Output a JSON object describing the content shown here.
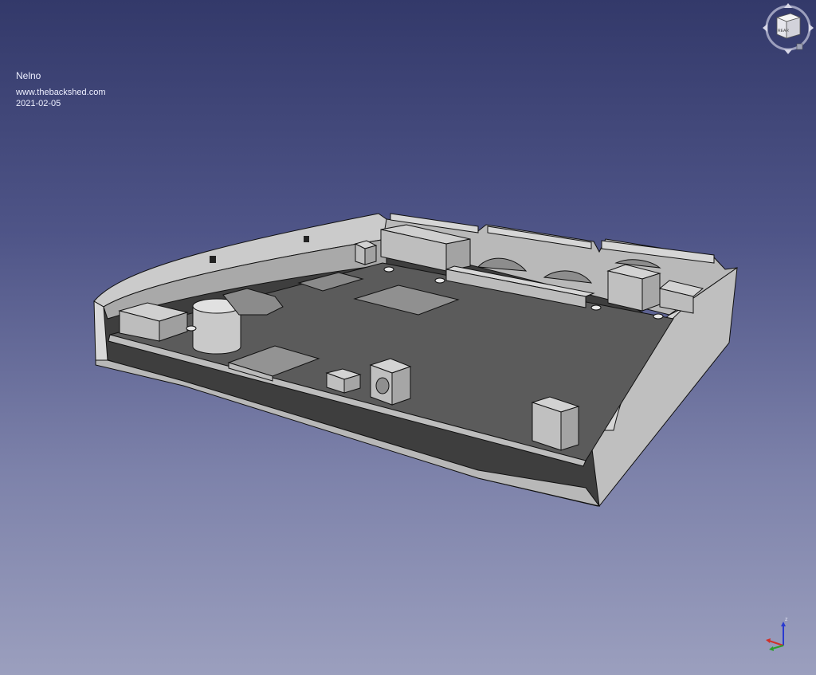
{
  "overlay": {
    "name": "Nelno",
    "website": "www.thebackshed.com",
    "date": "2021-02-05"
  },
  "navcube": {
    "face_label": "REAR",
    "icon": "navigation-cube-icon"
  },
  "axis": {
    "z_label": "z",
    "icon": "axis-cross-icon",
    "colors": {
      "x": "#d0302a",
      "y": "#2aa02a",
      "z": "#2a3ad0"
    }
  },
  "colors": {
    "background_top": "#33396a",
    "background_bottom": "#9b9fbe",
    "enclosure_light": "#cfcfcf",
    "enclosure_mid": "#a8a8a8",
    "pcb": "#5a5a5a",
    "component": "#c4c4c4"
  }
}
